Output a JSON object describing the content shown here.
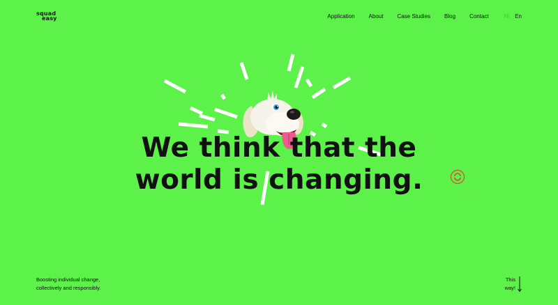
{
  "brand": {
    "logo_line1": "squad",
    "logo_line2": "easy"
  },
  "nav": {
    "items": [
      {
        "label": "Application"
      },
      {
        "label": "About"
      },
      {
        "label": "Case Studies"
      },
      {
        "label": "Blog"
      },
      {
        "label": "Contact"
      }
    ],
    "lang_nl": "Nl",
    "lang_en": "En"
  },
  "hero": {
    "line1": "We think that the",
    "line2": "world is changing."
  },
  "footer": {
    "tagline_line1": "Boosting individual change,",
    "tagline_line2": "collectively and responsibly.",
    "scroll_line1": "This",
    "scroll_line2": "way!"
  },
  "colors": {
    "background": "#5cf24a",
    "text": "#111111",
    "accent_target": "#e8452c",
    "burst": "#ffffff"
  },
  "icons": {
    "hero_image": "dog-head-illustration",
    "target": "circle-target-icon",
    "scroll": "arrow-down-icon"
  }
}
